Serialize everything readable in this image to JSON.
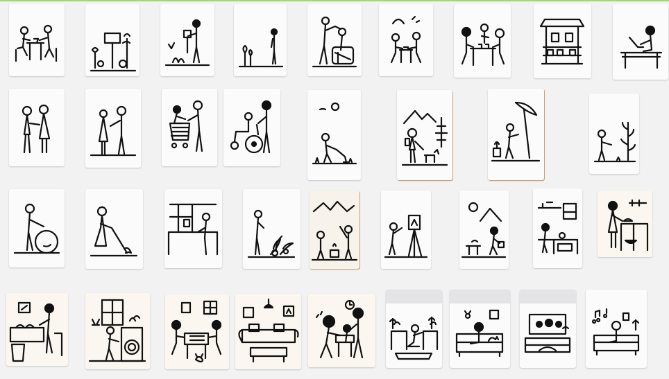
{
  "colors": {
    "background": "#f2f2f2",
    "card": "#fbfbfb",
    "ink": "#111111",
    "accent_top_line": "#9bd87a",
    "card_edge_tan": "#c9a27a"
  },
  "grid": {
    "rows": 4,
    "cards": [
      {
        "name": "card-two-people-desk",
        "scene": "two-people-desk"
      },
      {
        "name": "card-garden-sign",
        "scene": "garden-sign"
      },
      {
        "name": "card-person-garden-stand",
        "scene": "person-garden-stand"
      },
      {
        "name": "card-person-standing-plant",
        "scene": "person-standing-plant"
      },
      {
        "name": "card-person-with-child-play",
        "scene": "person-with-child-play"
      },
      {
        "name": "card-two-people-picnic",
        "scene": "two-people-picnic"
      },
      {
        "name": "card-group-at-table",
        "scene": "group-at-table"
      },
      {
        "name": "card-shop-stall",
        "scene": "shop-stall"
      },
      {
        "name": "card-person-at-laptop",
        "scene": "person-at-laptop"
      },
      {
        "name": "card-couple-standing",
        "scene": "couple-standing"
      },
      {
        "name": "card-two-people-talking",
        "scene": "two-people-talking"
      },
      {
        "name": "card-couple-shopping-cart",
        "scene": "couple-shopping-cart"
      },
      {
        "name": "card-wheelchair-helper",
        "scene": "wheelchair-helper"
      },
      {
        "name": "card-child-watering",
        "scene": "child-watering"
      },
      {
        "name": "card-hiker-with-dog",
        "scene": "hiker-with-dog"
      },
      {
        "name": "card-child-umbrella",
        "scene": "child-umbrella"
      },
      {
        "name": "card-child-with-tree",
        "scene": "child-with-tree"
      },
      {
        "name": "card-person-pushing-wheel",
        "scene": "person-pushing-wheel"
      },
      {
        "name": "card-person-sweeping",
        "scene": "person-sweeping"
      },
      {
        "name": "card-person-kitchen-window",
        "scene": "person-kitchen-window"
      },
      {
        "name": "card-person-plants",
        "scene": "person-plants"
      },
      {
        "name": "card-children-campfire",
        "scene": "children-campfire"
      },
      {
        "name": "card-child-easel",
        "scene": "child-easel"
      },
      {
        "name": "card-child-walk-mountains",
        "scene": "child-walk-mountains"
      },
      {
        "name": "card-child-kitchen",
        "scene": "child-kitchen"
      },
      {
        "name": "card-person-cooking",
        "scene": "person-cooking"
      },
      {
        "name": "card-washing-dishes",
        "scene": "washing-dishes"
      },
      {
        "name": "card-laundry-machine",
        "scene": "laundry-machine"
      },
      {
        "name": "card-family-board-game",
        "scene": "family-board-game"
      },
      {
        "name": "card-living-room-sofa",
        "scene": "living-room-sofa"
      },
      {
        "name": "card-grandparent-child-reading",
        "scene": "grandparent-child-reading"
      },
      {
        "name": "card-person-plants-rug",
        "scene": "person-plants-rug"
      },
      {
        "name": "card-person-sofa-cat",
        "scene": "person-sofa-cat"
      },
      {
        "name": "card-family-tv",
        "scene": "family-tv"
      },
      {
        "name": "card-person-sofa-music",
        "scene": "person-sofa-music"
      }
    ]
  }
}
